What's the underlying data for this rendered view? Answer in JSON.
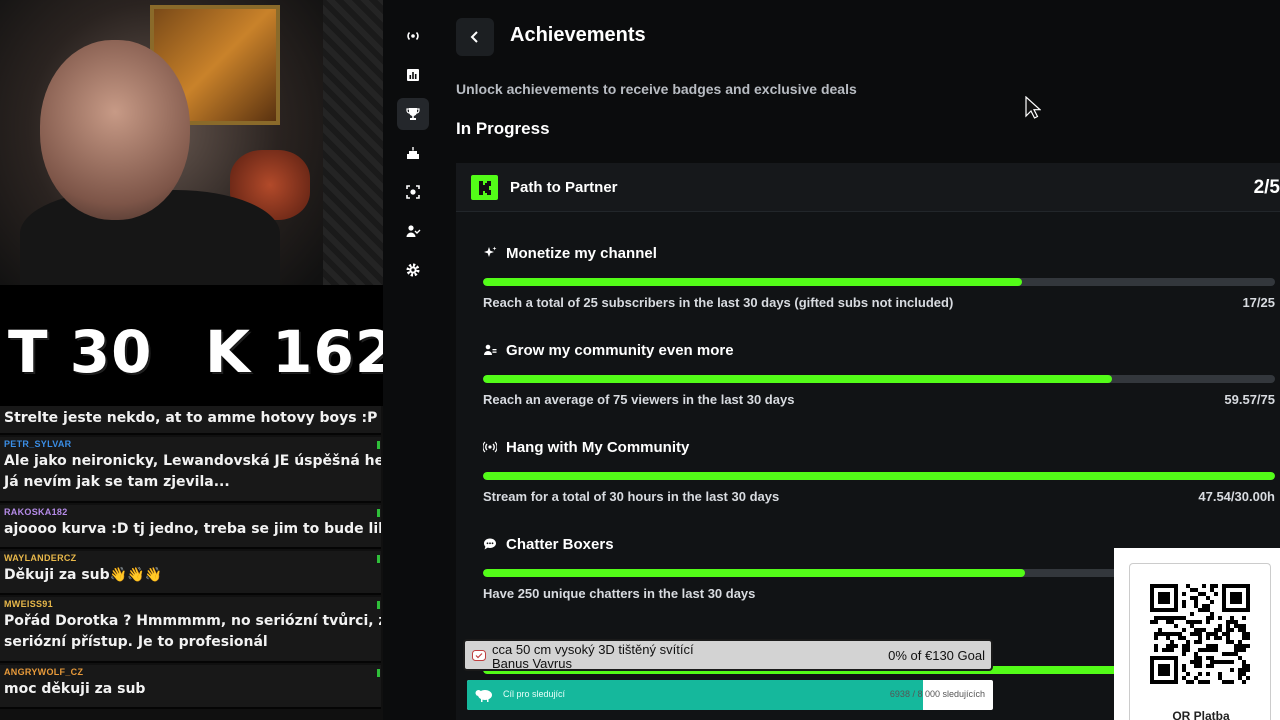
{
  "webcam": {
    "overlay_left": "T 30",
    "overlay_right": "K 162"
  },
  "chat": {
    "messages": [
      {
        "user": "",
        "text": "Strelte jeste nekdo, at to amme hotovy boys :P",
        "color": "#ffffff"
      },
      {
        "user": "PETR_SYLVAR",
        "text": "Ale jako neironicky, Lewandovská JE úspěšná herečka..",
        "text2": "Já nevím jak se tam zjevila...",
        "color": "#3a8ee6"
      },
      {
        "user": "RAKOSKA182",
        "text": "ajoooo kurva :D tj jedno, treba se jim to bude libit :P",
        "color": "#b58be8"
      },
      {
        "user": "WAYLANDERCZ",
        "text": "Děkuji za sub👋👋👋",
        "color": "#e8b84a"
      },
      {
        "user": "MWEISS91",
        "text": "Pořád Dorotka ? Hmmmmm, no seriózní tvůrci, zasloužb",
        "text2": "seriózní přístup. Je to profesionál",
        "color": "#e8b84a"
      },
      {
        "user": "ANGRYWOLF_CZ",
        "text": "moc děkuji za sub",
        "color": "#e89a3a"
      }
    ]
  },
  "sidebar": {
    "items": [
      {
        "icon": "broadcast-icon",
        "active": false
      },
      {
        "icon": "analytics-icon",
        "active": false
      },
      {
        "icon": "trophy-icon",
        "active": true
      },
      {
        "icon": "cake-icon",
        "active": false
      },
      {
        "icon": "capture-icon",
        "active": false
      },
      {
        "icon": "users-icon",
        "active": false
      },
      {
        "icon": "gear-icon",
        "active": false
      }
    ]
  },
  "page": {
    "title": "Achievements",
    "subtitle": "Unlock achievements to receive badges and exclusive deals",
    "section": "In Progress"
  },
  "card": {
    "title": "Path to Partner",
    "count": "2/5",
    "accent": "#53fc18"
  },
  "achievements": [
    {
      "icon": "sparkle-icon",
      "title": "Monetize my channel",
      "desc": "Reach a total of 25 subscribers in the last 30 days (gifted subs not included)",
      "value": "17/25",
      "progress": 0.68
    },
    {
      "icon": "community-icon",
      "title": "Grow my community even more",
      "desc": "Reach an average of 75 viewers in the last 30 days",
      "value": "59.57/75",
      "progress": 0.794
    },
    {
      "icon": "broadcast-icon",
      "title": "Hang with My Community",
      "desc": "Stream for a total of 30 hours in the last 30 days",
      "value": "47.54/30.00h",
      "progress": 1.0
    },
    {
      "icon": "chat-icon",
      "title": "Chatter Boxers",
      "desc": "Have 250 unique chatters in the last 30 days",
      "value": "",
      "progress": 0.684
    },
    {
      "icon": "",
      "title": "",
      "desc": "",
      "value": "",
      "progress": 1.0
    }
  ],
  "goal": {
    "line1": "cca 50 cm vysoký 3D tištěný svítící",
    "line2": "Banus Vavrus",
    "percent": "0% of €130 Goal"
  },
  "follower_goal": {
    "label": "Cíl pro sledující",
    "count": "6938 / 8 000 sledujících",
    "progress": 0.867
  },
  "qr": {
    "label": "QR Platba"
  }
}
